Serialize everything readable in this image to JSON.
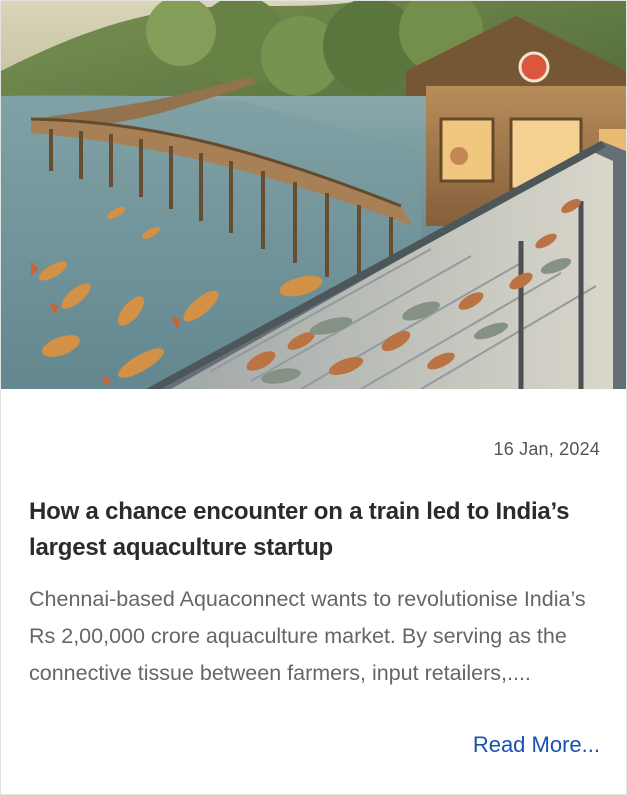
{
  "article": {
    "date": "16 Jan, 2024",
    "title": "How a chance encounter on a train led to India’s largest aquaculture startup",
    "excerpt": "Chennai-based Aquaconnect wants to revolutionise India’s Rs 2,00,000 crore aquaculture market. By serving as the connective tissue between farmers, input retailers,....",
    "read_more_label": "Read More..."
  },
  "colors": {
    "accent_link": "#1a4fb4",
    "title_text": "#2b2b2b",
    "body_text": "#666666",
    "date_text": "#555555",
    "card_border": "#e3e3e3"
  }
}
